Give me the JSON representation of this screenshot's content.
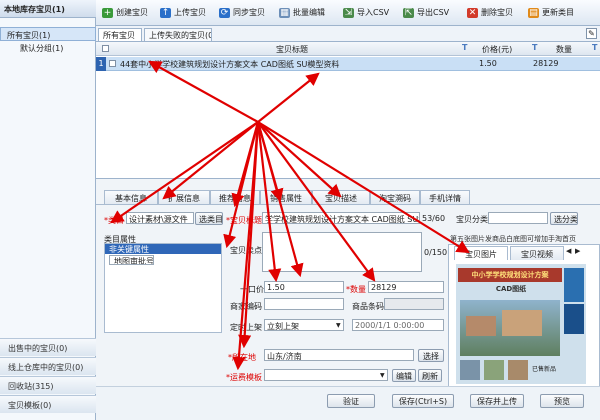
{
  "left": {
    "title": "本地库存宝贝(1)",
    "items": [
      {
        "label": "所有宝贝(1)"
      },
      {
        "label": "默认分组(1)"
      }
    ],
    "bottom": [
      {
        "label": "出售中的宝贝(0)"
      },
      {
        "label": "线上仓库中的宝贝(0)"
      },
      {
        "label": "回收站(315)"
      },
      {
        "label": "宝贝模板(0)"
      }
    ]
  },
  "toolbar": {
    "buttons": [
      {
        "label": "创建宝贝",
        "icon": "plus-icon"
      },
      {
        "label": "上传宝贝",
        "icon": "upload-icon"
      },
      {
        "label": "同步宝贝",
        "icon": "sync-icon"
      },
      {
        "label": "批量编辑",
        "icon": "batch-edit-icon"
      },
      {
        "label": "导入CSV",
        "icon": "import-icon"
      },
      {
        "label": "导出CSV",
        "icon": "export-icon"
      },
      {
        "label": "删除宝贝",
        "icon": "delete-icon"
      },
      {
        "label": "更新类目",
        "icon": "update-icon"
      }
    ]
  },
  "tabs1": [
    "所有宝贝",
    "上传失败的宝贝(0)"
  ],
  "grid": {
    "headers": {
      "title": "宝贝标题",
      "price": "价格(元)",
      "qty": "数量"
    },
    "row": {
      "num": "1",
      "title": "44套中小学学校建筑规划设计方案文本 CAD图纸 SU模型资料",
      "price": "1.50",
      "qty": "28129"
    }
  },
  "tabs2": [
    "基本信息",
    "扩展信息",
    "推荐信息",
    "销售属性",
    "宝贝描述",
    "淘宝溯码",
    "手机详情"
  ],
  "form": {
    "category_label": "*类目",
    "category_value": "设计素材\\源文件",
    "select_category_btn": "选类目",
    "category_attr_title": "类目属性",
    "attr_group": "非关键属性",
    "attr_item": "地图审批号",
    "title_label": "*宝贝标题",
    "title_value": "学学校建筑规划设计方案文本 CAD图纸 SU模型资料",
    "title_counter": "53/60",
    "shop_category_label": "宝贝分类",
    "shop_category_btn": "选分类",
    "selling_label": "宝贝卖点",
    "selling_counter": "0/150",
    "price_label": "一口价",
    "price_value": "1.50",
    "qty_label": "*数量",
    "qty_value": "28129",
    "merchant_code_label": "商家编码",
    "barcode_label": "商品条码",
    "listing_label": "定时上架",
    "listing_value": "立刻上架",
    "listing_date": "2000/1/1 0:00:00",
    "location_label": "*所在地",
    "location_value": "山东/济南",
    "location_btn": "选择",
    "shipping_label": "*运费模板",
    "shipping_edit": "编辑",
    "shipping_refresh": "刷新"
  },
  "image_panel": {
    "notice": "第五张图片发商品白底图可增加手淘首页",
    "tab_images": "宝贝图片",
    "tab_video": "宝贝视频",
    "banner_line1": "中小学学校规划设计方案",
    "banner_line2": "CAD图纸",
    "thumb_caption": "已售新品"
  },
  "bottom_buttons": {
    "validate": "验证",
    "save": "保存(Ctrl+S)",
    "save_upload": "保存并上传",
    "preview": "预览"
  }
}
